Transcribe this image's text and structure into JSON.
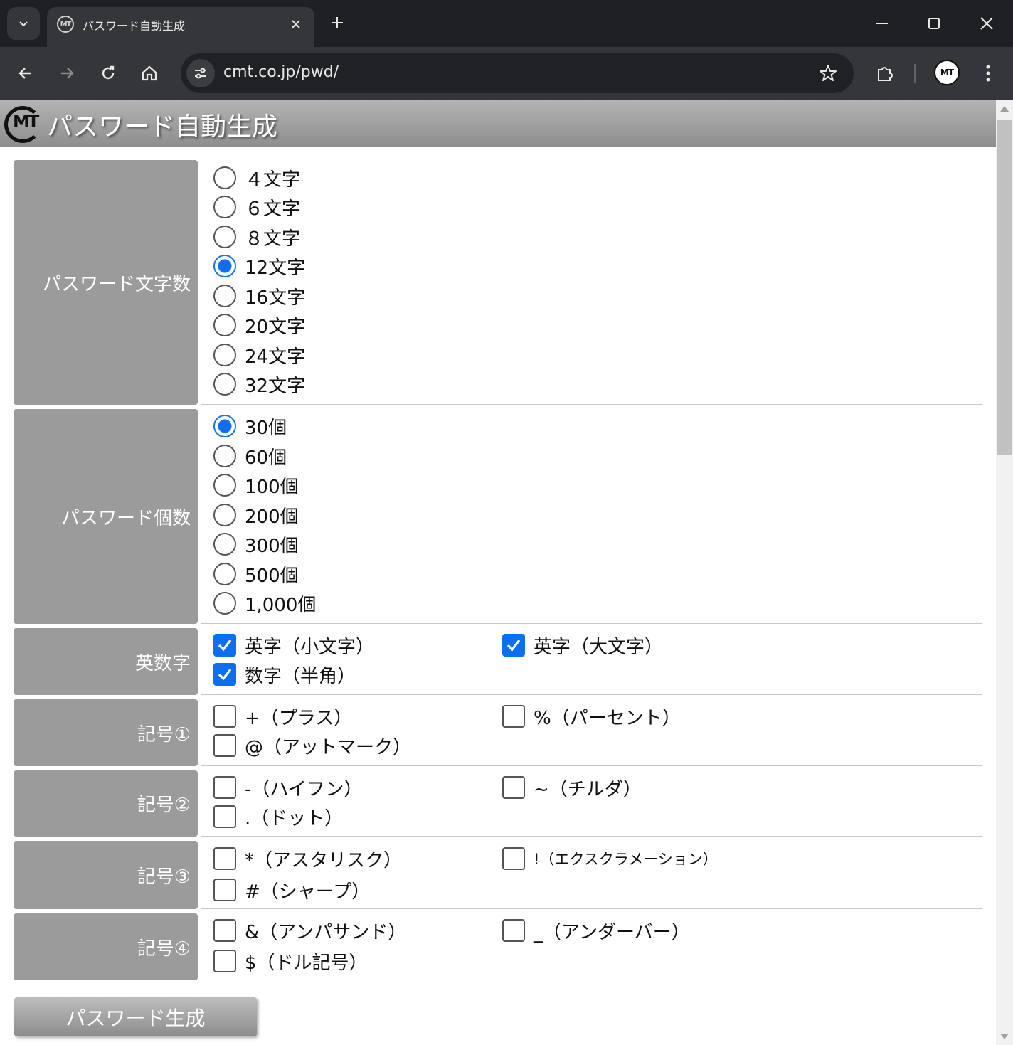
{
  "browser": {
    "tab_title": "パスワード自動生成",
    "favicon_text": "MT",
    "url": "cmt.co.jp/pwd/",
    "profile_text": "MT"
  },
  "header": {
    "logo_text": "MT",
    "title": "パスワード自動生成"
  },
  "length": {
    "label": "パスワード文字数",
    "options": [
      "４文字",
      "６文字",
      "８文字",
      "12文字",
      "16文字",
      "20文字",
      "24文字",
      "32文字"
    ],
    "selected": "12文字"
  },
  "count": {
    "label": "パスワード個数",
    "options": [
      "30個",
      "60個",
      "100個",
      "200個",
      "300個",
      "500個",
      "1,000個"
    ],
    "selected": "30個"
  },
  "alnum": {
    "label": "英数字",
    "options": [
      {
        "label": "英字（小文字）",
        "checked": true
      },
      {
        "label": "英字（大文字）",
        "checked": true
      },
      {
        "label": "数字（半角）",
        "checked": true
      }
    ]
  },
  "symbols1": {
    "label": "記号①",
    "options": [
      {
        "label": "+（プラス）",
        "checked": false
      },
      {
        "label": "%（パーセント）",
        "checked": false
      },
      {
        "label": "@（アットマーク）",
        "checked": false
      }
    ]
  },
  "symbols2": {
    "label": "記号②",
    "options": [
      {
        "label": "-（ハイフン）",
        "checked": false
      },
      {
        "label": "~（チルダ）",
        "checked": false
      },
      {
        "label": ".（ドット）",
        "checked": false
      }
    ]
  },
  "symbols3": {
    "label": "記号③",
    "options": [
      {
        "label": "*（アスタリスク）",
        "checked": false
      },
      {
        "label": "!（エクスクラメーション）",
        "checked": false
      },
      {
        "label": "#（シャープ）",
        "checked": false
      }
    ]
  },
  "symbols4": {
    "label": "記号④",
    "options": [
      {
        "label": "&（アンパサンド）",
        "checked": false
      },
      {
        "label": "_（アンダーバー）",
        "checked": false
      },
      {
        "label": "$（ドル記号）",
        "checked": false
      }
    ]
  },
  "generate_button": "パスワード生成",
  "colors": {
    "accent": "#0b6ff0",
    "label_bg": "#9b9b9b",
    "chrome_dark": "#1f2023",
    "chrome_toolbar": "#35363a"
  },
  "icons": [
    "chevron-down-icon",
    "favicon-icon",
    "close-icon",
    "plus-icon",
    "minimize-icon",
    "maximize-icon",
    "window-close-icon",
    "back-icon",
    "forward-icon",
    "reload-icon",
    "home-icon",
    "site-settings-icon",
    "star-icon",
    "extensions-icon",
    "profile-icon",
    "menu-icon"
  ]
}
